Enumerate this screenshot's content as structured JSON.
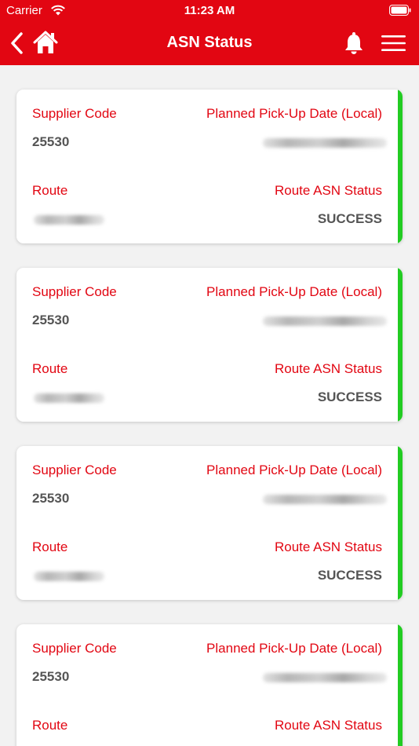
{
  "status_bar": {
    "carrier": "Carrier",
    "time": "11:23 AM"
  },
  "header": {
    "title": "ASN Status"
  },
  "labels": {
    "supplier_code": "Supplier Code",
    "planned_date": "Planned Pick-Up Date (Local)",
    "route": "Route",
    "route_status": "Route ASN Status"
  },
  "cards": [
    {
      "supplier_code": "25530",
      "route_asn_status": "SUCCESS"
    },
    {
      "supplier_code": "25530",
      "route_asn_status": "SUCCESS"
    },
    {
      "supplier_code": "25530",
      "route_asn_status": "SUCCESS"
    },
    {
      "supplier_code": "25530",
      "route_asn_status": ""
    }
  ],
  "colors": {
    "brand": "#e20612",
    "status_accent": "#22cc22",
    "value_text": "#555555"
  }
}
